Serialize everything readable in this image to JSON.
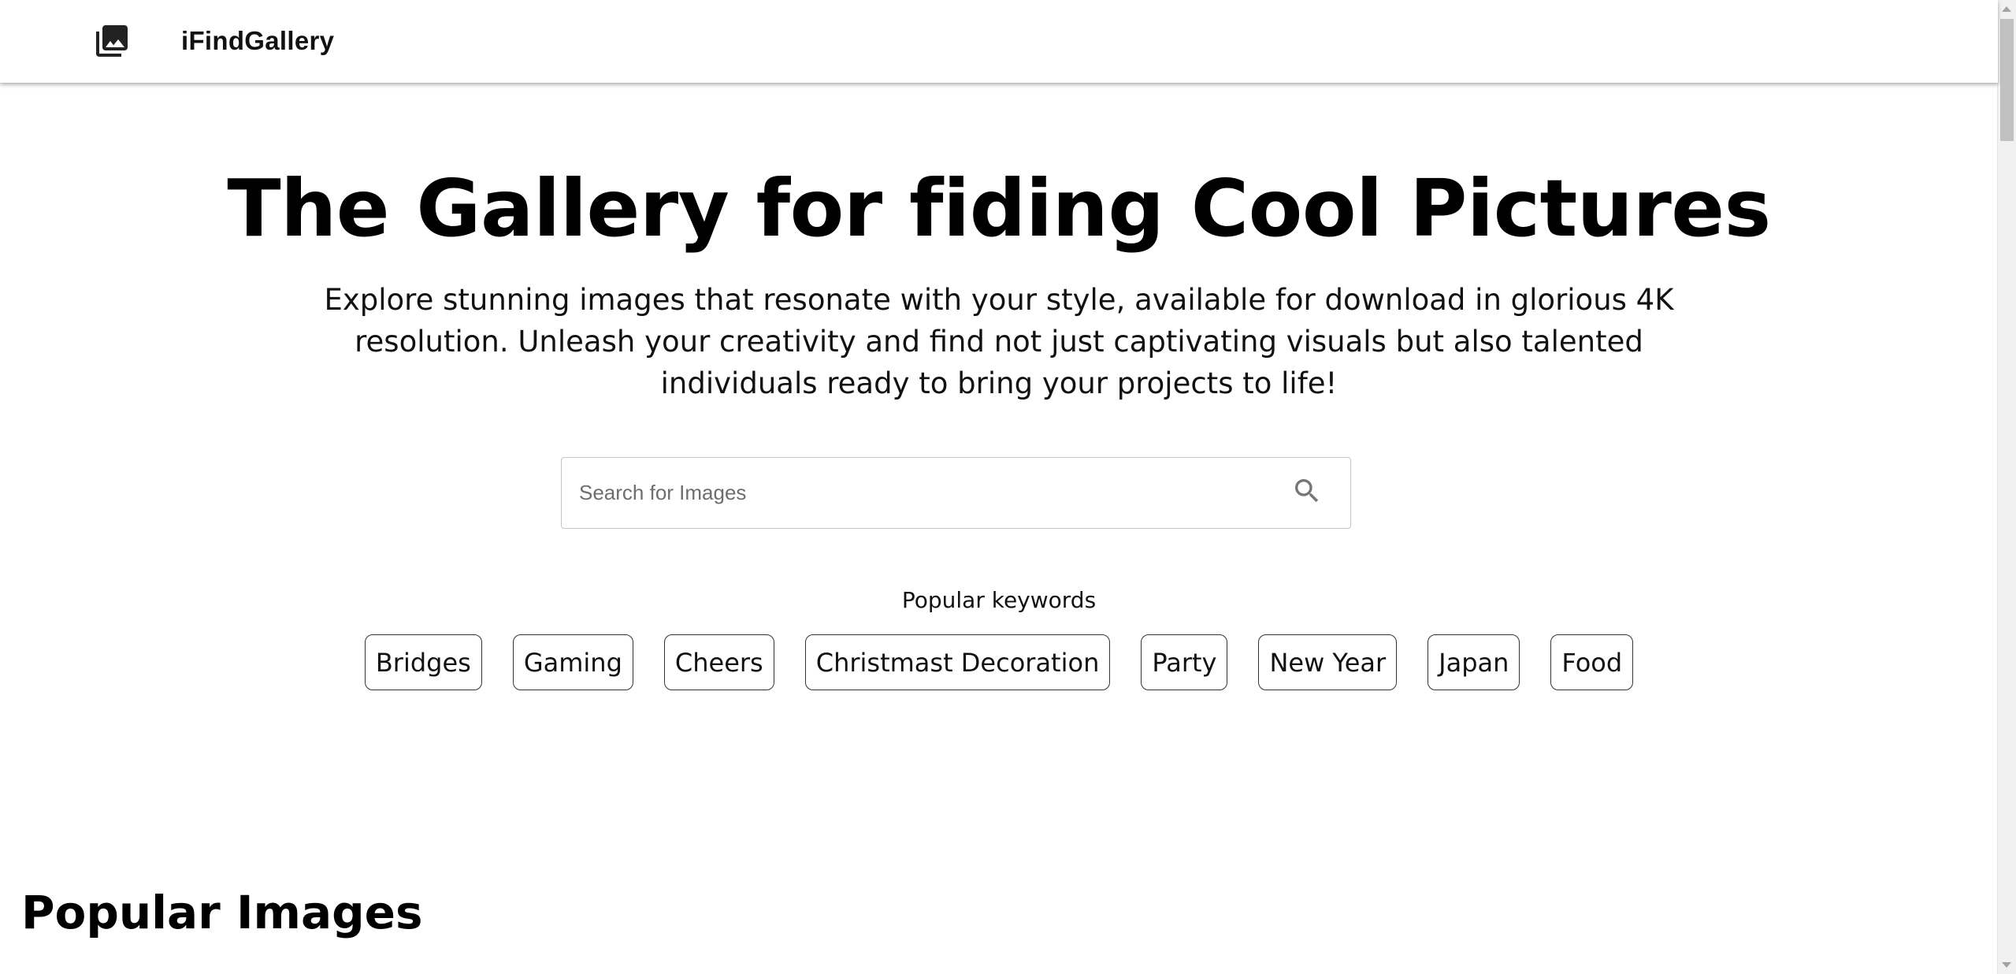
{
  "header": {
    "brand": "iFindGallery",
    "logo_icon": "photo-library-icon"
  },
  "hero": {
    "title": "The Gallery for fiding Cool Pictures",
    "description": "Explore stunning images that resonate with your style, available for download in glorious 4K resolution. Unleash your creativity and find not just captivating visuals but also talented individuals ready to bring your projects to life!"
  },
  "search": {
    "placeholder": "Search for Images",
    "value": "",
    "icon": "search-icon"
  },
  "keywords": {
    "label": "Popular keywords",
    "items": [
      "Bridges",
      "Gaming",
      "Cheers",
      "Christmast Decoration",
      "Party",
      "New Year",
      "Japan",
      "Food"
    ]
  },
  "popular": {
    "title": "Popular Images"
  },
  "colors": {
    "background": "#ffffff",
    "text": "#000000",
    "border": "#c4c4c4",
    "chip_border": "#333333"
  }
}
